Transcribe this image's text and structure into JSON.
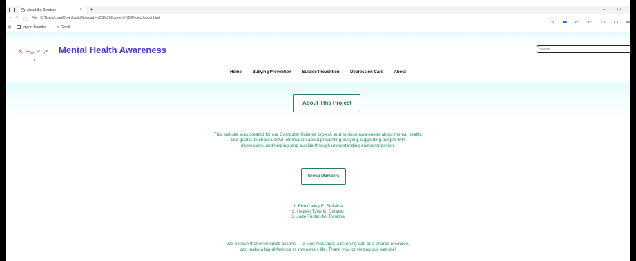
{
  "browser": {
    "tab_title": "About the Creators",
    "tab_close": "×",
    "new_tab": "+",
    "window_controls": "–  ⊡",
    "address_prefix": "File",
    "url": "C:/Users/chan/Downloads/Notepad++/CS%20Quarterly%20Project/about.html",
    "favorites": [
      {
        "label": "Import favorites"
      },
      {
        "label": "Gmail"
      }
    ]
  },
  "site": {
    "title": "Mental Health Awareness",
    "search_placeholder": "Search...",
    "nav": [
      "Home",
      "Bullying Prevention",
      "Suicide Prevention",
      "Depression Care",
      "About"
    ]
  },
  "content": {
    "about_title": "About This Project",
    "intro": [
      "This website was created for our Computer Science project, and to raise awareness about mental health.",
      "Our goal is to share useful information about preventing bullying, supporting people with",
      "depression, and helping stop suicide through understanding and compassion."
    ],
    "group_title": "Group Members",
    "members": [
      "1. Erin Cailey E. Felisilda",
      "2. Hezeki Tyler G. Salazar",
      "3. Jude Tristan M. Torralba"
    ],
    "closing": [
      "We believe that even small actions — a kind message, a listening ear, or a shared resource,",
      "can make a big difference in someone's life. Thank you for visiting our website!"
    ]
  },
  "colors": {
    "title": "#4b38c9",
    "accent": "#1f8a62",
    "box_border": "#2a7a62"
  }
}
